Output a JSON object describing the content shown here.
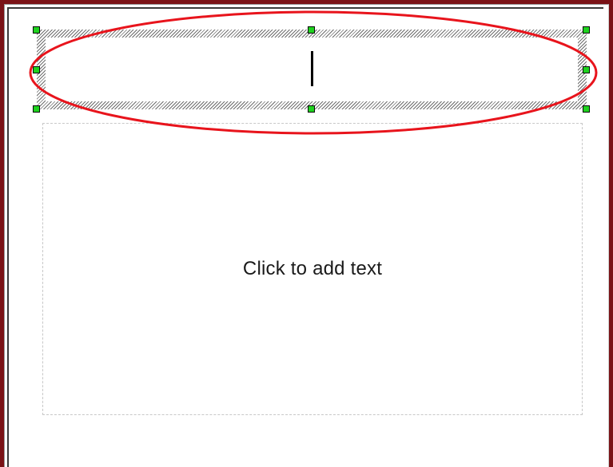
{
  "slide": {
    "title_placeholder": {
      "state": "editing",
      "text": ""
    },
    "body_placeholder": {
      "text": "Click to add text"
    }
  },
  "colors": {
    "frame": "#7a1216",
    "selection_handle": "#1fd21f",
    "annotation_ellipse": "#e8141c"
  },
  "icons": [
    "selection-handle"
  ]
}
